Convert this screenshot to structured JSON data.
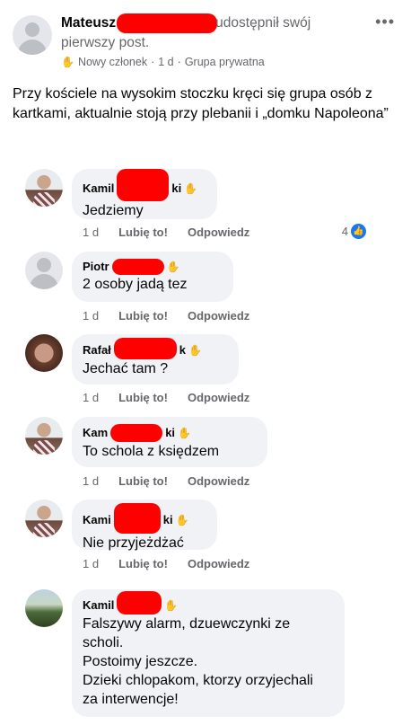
{
  "post": {
    "author_first": "Mateusz",
    "shared_text": "udostępnił swój pierwszy post.",
    "badge": "Nowy członek",
    "time": "1 d",
    "separator": "·",
    "audience": "Grupa prywatna",
    "more": "•••",
    "body": "Przy kościele na wysokim stoczku kręci się grupa osób z kartkami, aktualnie stoją przy plebanii i „domku Napoleona”"
  },
  "comments": [
    {
      "name": "Kamil",
      "name_tail": "ki",
      "text": "Jedziemy",
      "time": "1 d",
      "like": "Lubię to!",
      "reply": "Odpowiedz",
      "reactions": "4"
    },
    {
      "name": "Piotr",
      "name_tail": "",
      "text": "2 osoby jadą tez",
      "time": "1 d",
      "like": "Lubię to!",
      "reply": "Odpowiedz"
    },
    {
      "name": "Rafał",
      "name_tail": "k",
      "text": "Jechać tam ?",
      "time": "1 d",
      "like": "Lubię to!",
      "reply": "Odpowiedz"
    },
    {
      "name": "Kam",
      "name_tail": "ki",
      "text": "To schola z księdzem",
      "time": "1 d",
      "like": "Lubię to!",
      "reply": "Odpowiedz"
    },
    {
      "name": "Kami",
      "name_tail": "ki",
      "text": "Nie przyjeżdżać",
      "time": "1 d",
      "like": "Lubię to!",
      "reply": "Odpowiedz"
    },
    {
      "name": "Kamil",
      "name_tail": "",
      "text_lines": [
        "Falszywy alarm, dzuewczynki ze",
        "scholi.",
        "Postoimy jeszcze.",
        "Dzieki chlopakom, ktorzy orzyjechali",
        "za interwencje!"
      ]
    }
  ],
  "colors": {
    "redaction": "#ff0000",
    "bubble": "#f0f2f5",
    "meta": "#65676b",
    "like_blue": "#1877f2"
  }
}
